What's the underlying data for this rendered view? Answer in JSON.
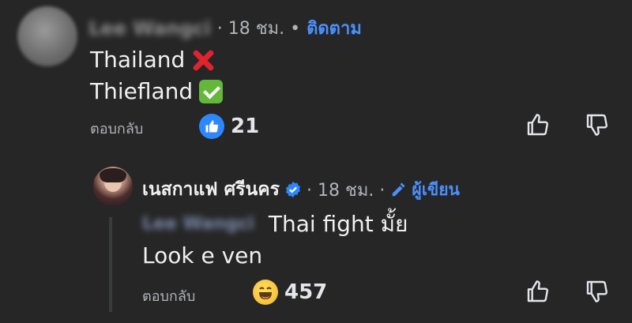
{
  "comment1": {
    "author": "Lee Wangci",
    "time": "· 18 ชม. •",
    "follow_label": "ติดตาม",
    "lines": [
      "Thailand",
      "Thiefland"
    ],
    "reply_label": "ตอบกลับ",
    "like_count": "21"
  },
  "comment2": {
    "author": "เนสกาแฟ ศรีนคร",
    "time": "· 18 ชม. ·",
    "author_badge": "ผู้เขียน",
    "mention": "Lee Wangci",
    "line1": "Thai fight มั้ย",
    "line2": "Look e ven",
    "reply_label": "ตอบกลับ",
    "reaction_count": "457"
  },
  "colors": {
    "background": "#262626",
    "link_blue": "#4a90ff",
    "like_blue": "#2d88ff",
    "muted_text": "#b0b3b8"
  }
}
